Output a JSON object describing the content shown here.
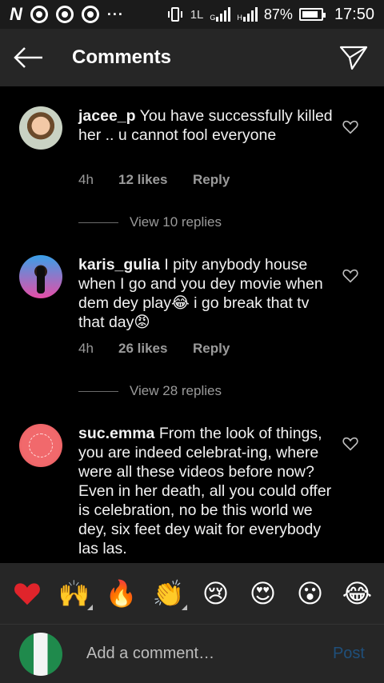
{
  "status_bar": {
    "battery": "87%",
    "time": "17:50",
    "network_labels": [
      "1L",
      "G",
      "H"
    ],
    "battery_level": 0.87
  },
  "header": {
    "title": "Comments"
  },
  "comments": [
    {
      "username": "jacee_p",
      "text": "You have successfully killed her .. u cannot fool everyone",
      "time": "4h",
      "likes": "12 likes",
      "reply": "Reply",
      "view_replies": "View 10 replies"
    },
    {
      "username": "karis_gulia",
      "text": "I pity anybody house when I go and you dey movie when dem dey play😂 i go break that tv that day😡",
      "time": "4h",
      "likes": "26 likes",
      "reply": "Reply",
      "view_replies": "View 28 replies"
    },
    {
      "username": "suc.emma",
      "text": "From the look of things, you are indeed celebrat-ing, where were all these videos before now? Even in her death, all you could offer is celebration, no be this world we dey, six feet dey wait for everybody las las."
    }
  ],
  "emoji_bar": [
    {
      "name": "red-heart",
      "glyph": "❤️"
    },
    {
      "name": "raising-hands",
      "glyph": "🙌"
    },
    {
      "name": "fire",
      "glyph": "🔥"
    },
    {
      "name": "clapping-hands",
      "glyph": "👏"
    },
    {
      "name": "crying-face",
      "glyph": "😢"
    },
    {
      "name": "heart-eyes",
      "glyph": "😍"
    },
    {
      "name": "surprised-face",
      "glyph": "😮"
    },
    {
      "name": "tears-of-joy",
      "glyph": "😂"
    }
  ],
  "composer": {
    "placeholder": "Add a comment…",
    "post_label": "Post"
  },
  "colors": {
    "background": "#000000",
    "bar": "#262626",
    "secondary_text": "#9a9a9a",
    "post_disabled": "#1f4f7a"
  }
}
